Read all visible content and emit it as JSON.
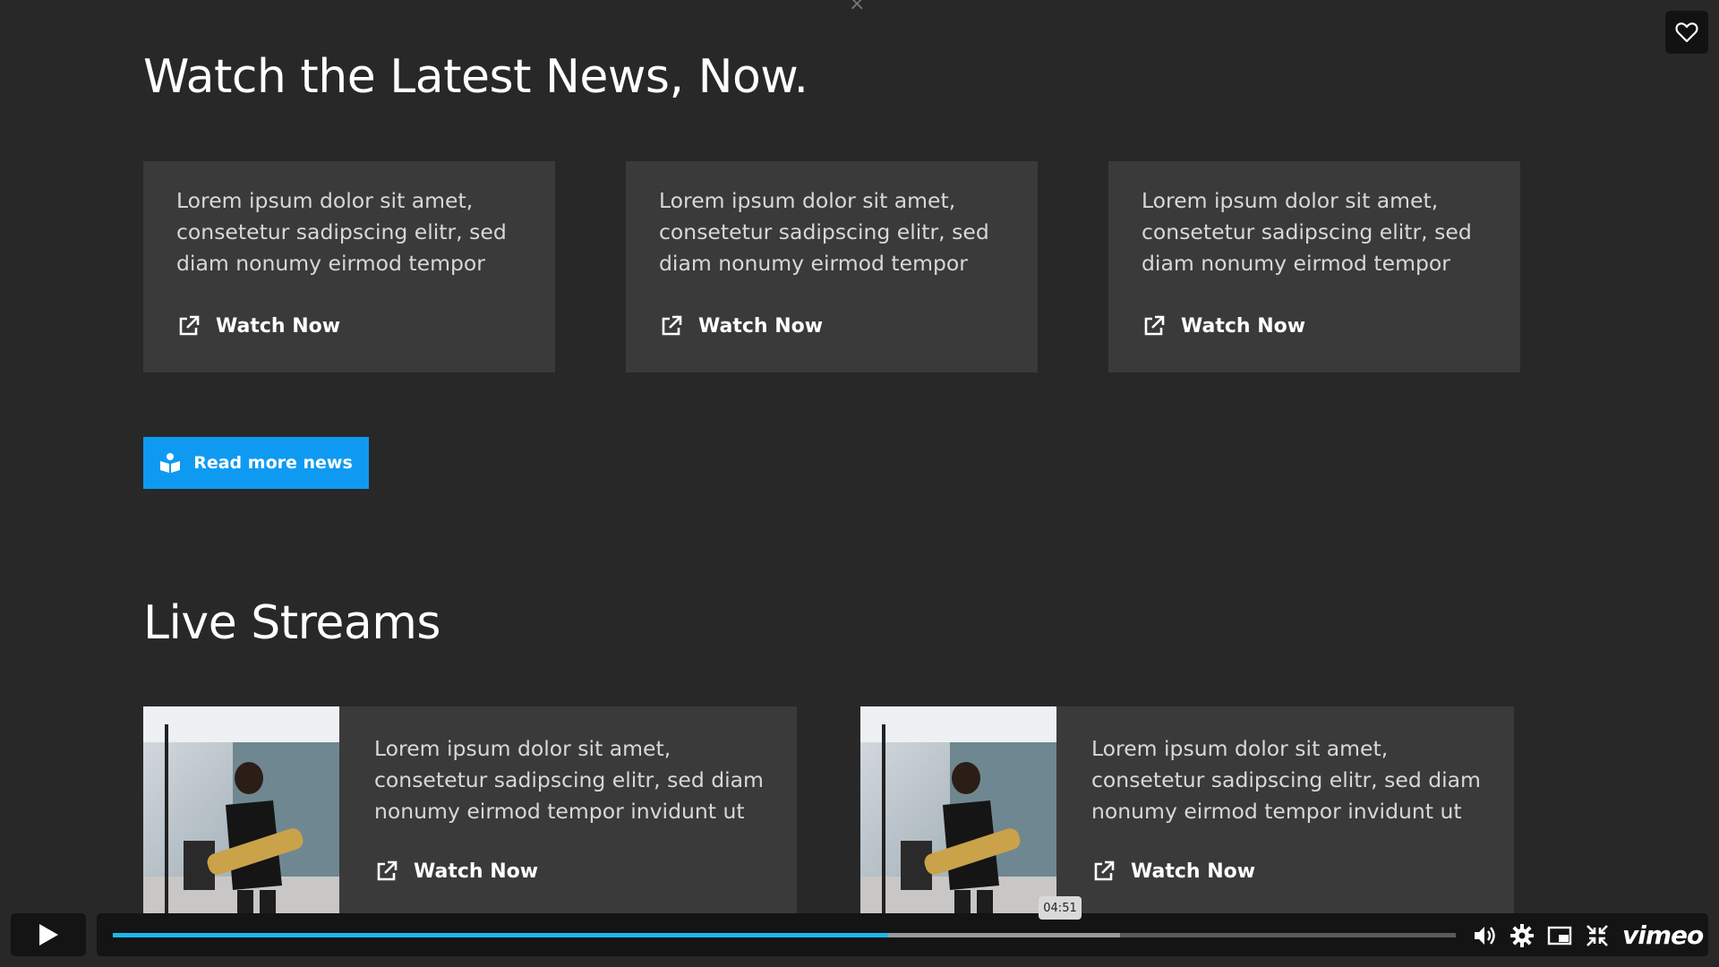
{
  "news": {
    "title": "Watch the Latest News, Now.",
    "cards": [
      {
        "text": "Lorem ipsum dolor sit amet, consetetur sadipscing elitr, sed diam nonumy eirmod tempor",
        "cta": "Watch Now"
      },
      {
        "text": "Lorem ipsum dolor sit amet, consetetur sadipscing elitr, sed diam nonumy eirmod tempor",
        "cta": "Watch Now"
      },
      {
        "text": "Lorem ipsum dolor sit amet, consetetur sadipscing elitr, sed diam nonumy eirmod tempor",
        "cta": "Watch Now"
      }
    ],
    "read_more": "Read more news"
  },
  "streams": {
    "title": "Live Streams",
    "cards": [
      {
        "text": "Lorem ipsum dolor sit amet, consetetur sadipscing elitr, sed diam nonumy eirmod tempor invidunt ut",
        "cta": "Watch Now"
      },
      {
        "text": "Lorem ipsum dolor sit amet, consetetur sadipscing elitr, sed diam nonumy eirmod tempor invidunt ut",
        "cta": "Watch Now"
      }
    ]
  },
  "player": {
    "time_tooltip": "04:51",
    "played_fraction": 0.577,
    "buffered_fraction": 0.75,
    "brand": "vimeo",
    "accent_color": "#1ab7ea"
  },
  "icons": {
    "heart": "heart-icon",
    "watch": "external-link-icon",
    "read_more": "reader-icon",
    "play": "play-icon",
    "volume": "volume-icon",
    "settings": "gear-icon",
    "pip": "picture-in-picture-icon",
    "fullscreen": "exit-fullscreen-icon"
  }
}
